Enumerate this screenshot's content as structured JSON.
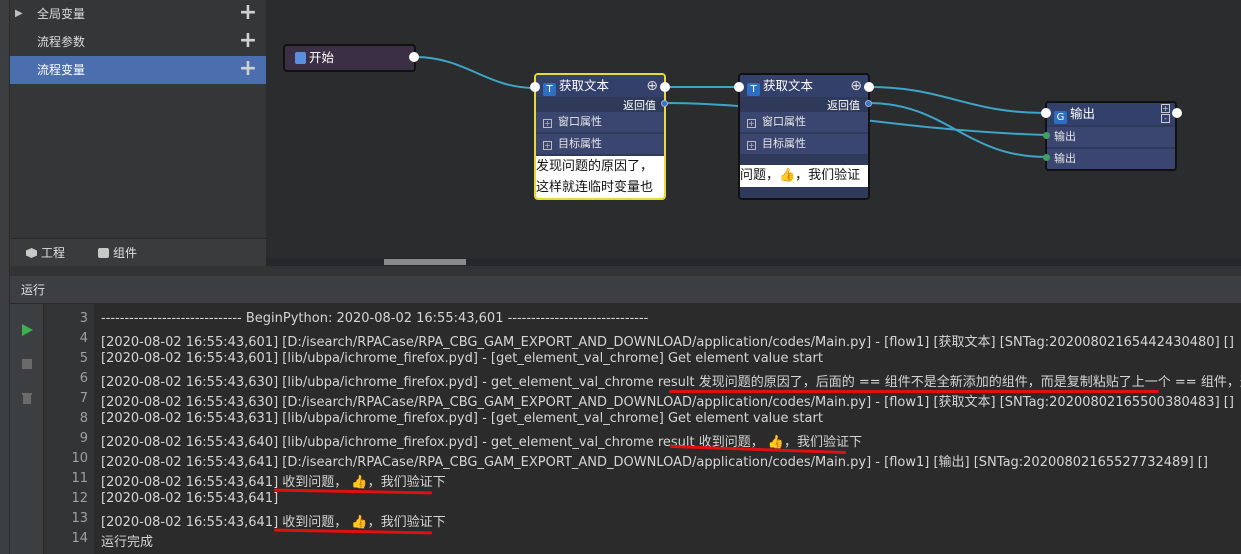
{
  "tree": {
    "items": [
      {
        "label": "全局变量",
        "selected": false
      },
      {
        "label": "流程参数",
        "selected": false
      },
      {
        "label": "流程变量",
        "selected": true
      }
    ],
    "add_symbol": "+",
    "expand_symbol": "▶"
  },
  "left_tabs": [
    {
      "label": "工程",
      "icon": "cube-icon"
    },
    {
      "label": "组件",
      "icon": "puzzle-icon"
    }
  ],
  "nodes": {
    "start": {
      "title": "开始"
    },
    "get_text_1": {
      "title": "获取文本",
      "return_label": "返回值",
      "rows": [
        "窗口属性",
        "目标属性"
      ],
      "preview_lines": [
        "发现问题的原因了，",
        "这样就连临时变量也"
      ]
    },
    "get_text_2": {
      "title": "获取文本",
      "return_label": "返回值",
      "rows": [
        "窗口属性",
        "目标属性"
      ],
      "preview_lines": [
        "问题，👍，我们验证"
      ]
    },
    "output": {
      "title": "输出",
      "inputs": [
        "输出",
        "输出"
      ]
    }
  },
  "run_panel": {
    "title": "运行",
    "lines": [
      {
        "n": "3",
        "text": "------------------------------ BeginPython: 2020-08-02 16:55:43,601 ------------------------------"
      },
      {
        "n": "4",
        "text": "[2020-08-02 16:55:43,601] [D:/isearch/RPACase/RPA_CBG_GAM_EXPORT_AND_DOWNLOAD/application/codes/Main.py] - [flow1] [获取文本] [SNTag:20200802165442430480] []"
      },
      {
        "n": "5",
        "text": "[2020-08-02 16:55:43,601] [lib/ubpa/ichrome_firefox.pyd] - [get_element_val_chrome] Get element value start"
      },
      {
        "n": "6",
        "text": "[2020-08-02 16:55:43,630] [lib/ubpa/ichrome_firefox.pyd] - get_element_val_chrome  result 发现问题的原因了，后面的 == 组件不是全新添加的组件，而是复制粘贴了上一个 == 组件，这样就"
      },
      {
        "n": "7",
        "text": "[2020-08-02 16:55:43,630] [D:/isearch/RPACase/RPA_CBG_GAM_EXPORT_AND_DOWNLOAD/application/codes/Main.py] - [flow1] [获取文本] [SNTag:20200802165500380483] []"
      },
      {
        "n": "8",
        "text": "[2020-08-02 16:55:43,631] [lib/ubpa/ichrome_firefox.pyd] - [get_element_val_chrome] Get element value start"
      },
      {
        "n": "9",
        "text": "[2020-08-02 16:55:43,640] [lib/ubpa/ichrome_firefox.pyd] - get_element_val_chrome  result 收到问题， 👍，我们验证下"
      },
      {
        "n": "10",
        "text": "[2020-08-02 16:55:43,641] [D:/isearch/RPACase/RPA_CBG_GAM_EXPORT_AND_DOWNLOAD/application/codes/Main.py] - [flow1] [输出] [SNTag:20200802165527732489] []"
      },
      {
        "n": "11",
        "text": "[2020-08-02 16:55:43,641] 收到问题， 👍，我们验证下"
      },
      {
        "n": "12",
        "text": "[2020-08-02 16:55:43,641]"
      },
      {
        "n": "13",
        "text": "[2020-08-02 16:55:43,641] 收到问题， 👍，我们验证下"
      },
      {
        "n": "14",
        "text": "运行完成"
      }
    ]
  },
  "colors": {
    "selected_row": "#4b6eaf",
    "node_body": "#2f3a5a",
    "start_node": "#3b2f45",
    "selected_node_border": "#e8d83a",
    "wire": "#3ea5c8",
    "run_icon": "#3fae4c",
    "annotation": "#e01010"
  }
}
